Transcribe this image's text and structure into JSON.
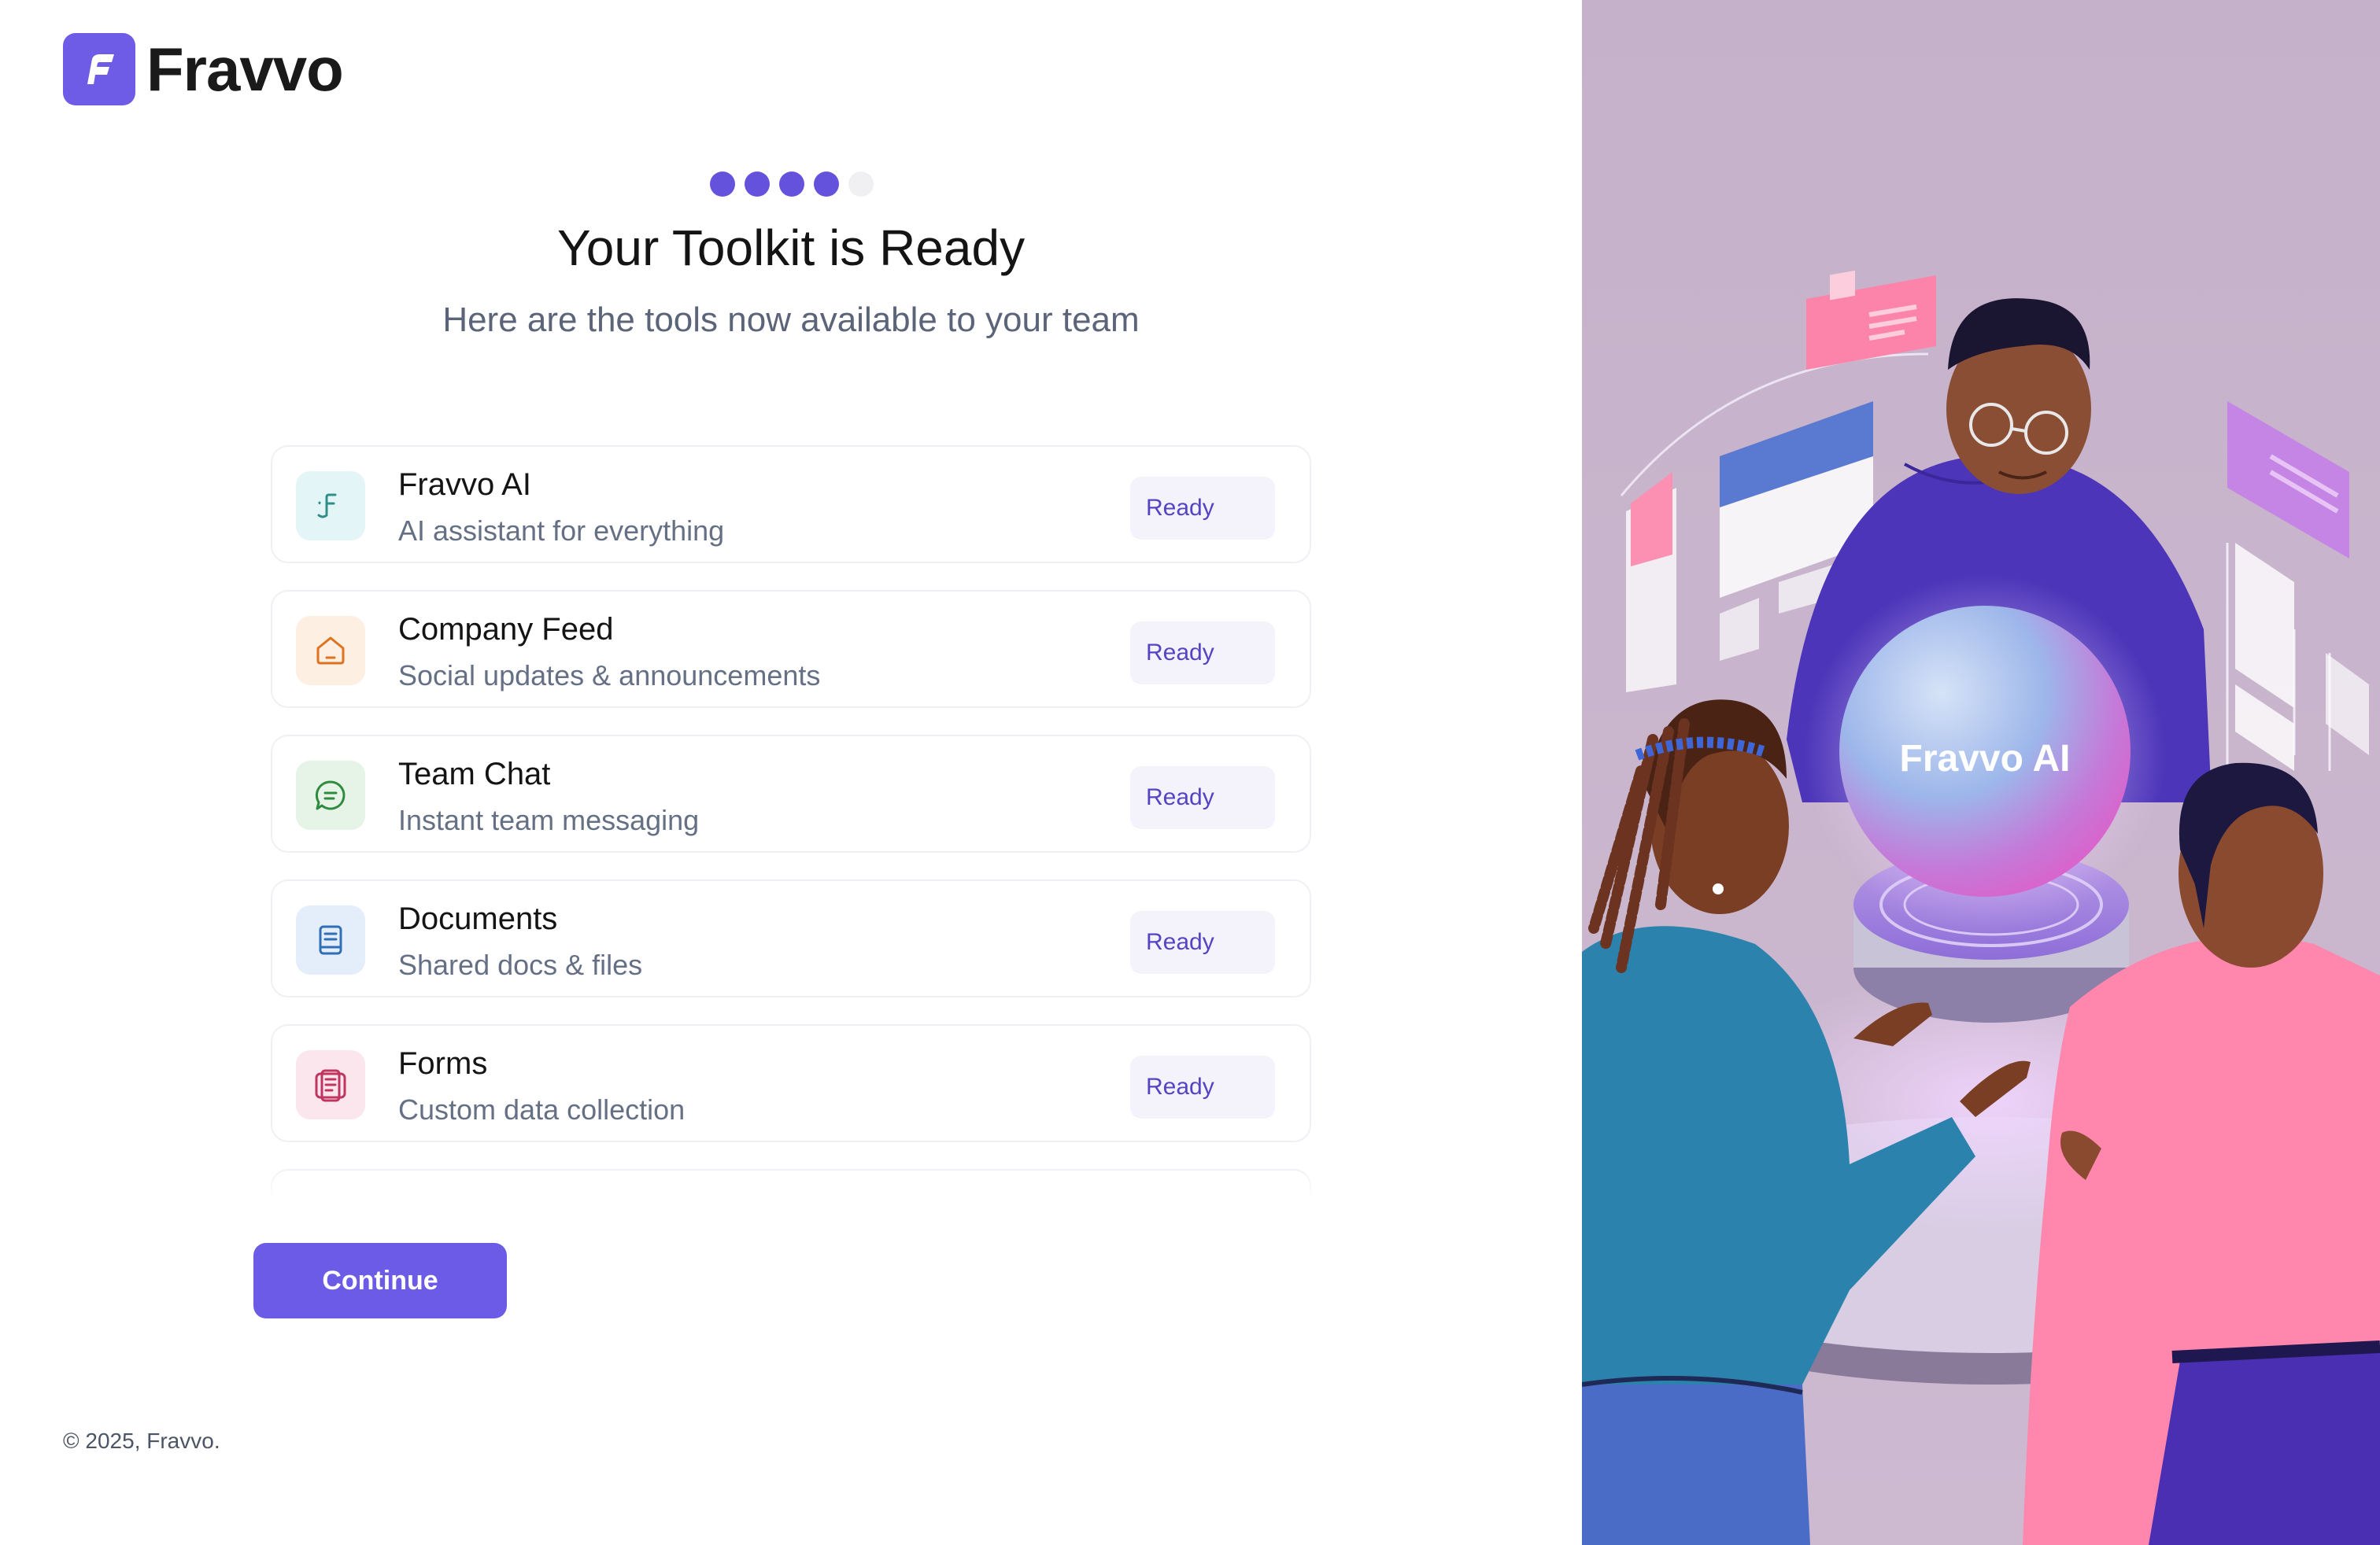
{
  "brand": {
    "name": "Fravvo",
    "accent": "#6b5be6"
  },
  "progress": {
    "total_steps": 5,
    "completed_steps": 4
  },
  "header": {
    "title": "Your Toolkit is Ready",
    "subtitle": "Here are the tools now available to your team"
  },
  "tools": [
    {
      "name": "Fravvo AI",
      "description": "AI assistant for everything",
      "status": "Ready",
      "icon": "fravvo-ai-icon",
      "icon_color": "#2f8f86",
      "icon_bg": "#e3f5f6"
    },
    {
      "name": "Company Feed",
      "description": "Social updates & announcements",
      "status": "Ready",
      "icon": "home-icon",
      "icon_color": "#e0711f",
      "icon_bg": "#fdf0e3"
    },
    {
      "name": "Team Chat",
      "description": "Instant team messaging",
      "status": "Ready",
      "icon": "chat-bubble-icon",
      "icon_color": "#2e8b3e",
      "icon_bg": "#e6f4e8"
    },
    {
      "name": "Documents",
      "description": "Shared docs & files",
      "status": "Ready",
      "icon": "document-icon",
      "icon_color": "#2f6fb8",
      "icon_bg": "#e4eefa"
    },
    {
      "name": "Forms",
      "description": "Custom data collection",
      "status": "Ready",
      "icon": "form-icon",
      "icon_color": "#c0355f",
      "icon_bg": "#fbe6ee"
    }
  ],
  "actions": {
    "continue_label": "Continue"
  },
  "footer": {
    "copyright": "© 2025, Fravvo."
  },
  "illustration": {
    "orb_label": "Fravvo AI"
  }
}
